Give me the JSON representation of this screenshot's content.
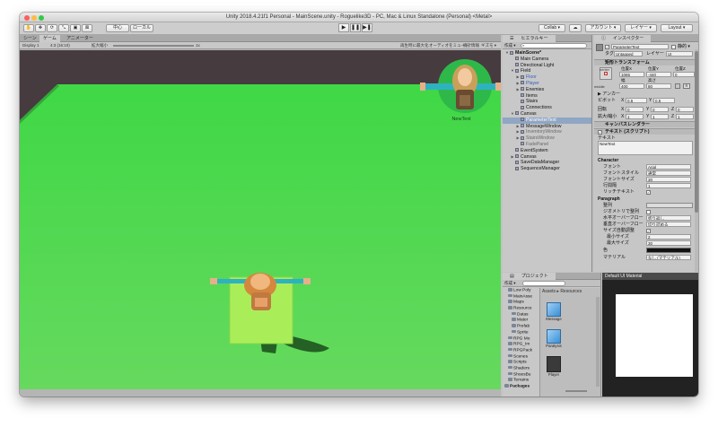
{
  "window": {
    "title": "Unity 2018.4.21f1 Personal - MainScene.unity - Roguelike3D - PC, Mac & Linux Standalone (Personal) <Metal>"
  },
  "toolbar": {
    "pivot_label": "中心",
    "space_label": "ローカル",
    "collab_label": "Collab ▾",
    "account_label": "アカウント ▾",
    "layers_label": "レイヤー ▾",
    "layout_label": "Layout ▾"
  },
  "scene": {
    "tabs": [
      "シーン",
      "ゲーム",
      "アニメーター"
    ],
    "display_label": "Display 1",
    "aspect_label": "4:3 (16:10)",
    "scale_label": "拡大縮小",
    "scale_value": "1x",
    "maximize_label": "再生時に最大化",
    "mute_label": "オーディオをミュート",
    "stats_label": "統計情報",
    "gizmos_label": "ギズモ ▾",
    "enemy_label": "NewText"
  },
  "hierarchy": {
    "tab_label": "ヒエラルキー",
    "create_label": "作成 ▾",
    "items": [
      {
        "label": "MainScene*",
        "indent": 0,
        "arrow": "▼",
        "style": "bold"
      },
      {
        "label": "Main Camera",
        "indent": 1,
        "arrow": "",
        "style": ""
      },
      {
        "label": "Directional Light",
        "indent": 1,
        "arrow": "",
        "style": ""
      },
      {
        "label": "Field",
        "indent": 1,
        "arrow": "▼",
        "style": ""
      },
      {
        "label": "Floor",
        "indent": 2,
        "arrow": "▶",
        "style": "blue"
      },
      {
        "label": "Player",
        "indent": 2,
        "arrow": "▶",
        "style": "blue"
      },
      {
        "label": "Enemies",
        "indent": 2,
        "arrow": "▶",
        "style": ""
      },
      {
        "label": "Items",
        "indent": 2,
        "arrow": "",
        "style": ""
      },
      {
        "label": "Stairs",
        "indent": 2,
        "arrow": "",
        "style": ""
      },
      {
        "label": "Connections",
        "indent": 2,
        "arrow": "",
        "style": ""
      },
      {
        "label": "Canvas",
        "indent": 1,
        "arrow": "▼",
        "style": ""
      },
      {
        "label": "ParameterText",
        "indent": 2,
        "arrow": "",
        "style": "sel"
      },
      {
        "label": "MessageWindow",
        "indent": 2,
        "arrow": "▶",
        "style": ""
      },
      {
        "label": "InventoryWindow",
        "indent": 2,
        "arrow": "▶",
        "style": "dim"
      },
      {
        "label": "StairsWindow",
        "indent": 2,
        "arrow": "▶",
        "style": "dim"
      },
      {
        "label": "FadePanel",
        "indent": 2,
        "arrow": "",
        "style": "dim"
      },
      {
        "label": "EventSystem",
        "indent": 1,
        "arrow": "",
        "style": ""
      },
      {
        "label": "Canvas",
        "indent": 1,
        "arrow": "▶",
        "style": ""
      },
      {
        "label": "SaveDataManager",
        "indent": 1,
        "arrow": "",
        "style": ""
      },
      {
        "label": "SequenceManager",
        "indent": 1,
        "arrow": "",
        "style": ""
      }
    ]
  },
  "inspector": {
    "tab_label": "インスペクター",
    "object_name": "ParameterText",
    "static_label": "静的 ▾",
    "tag_label": "タグ",
    "tag_value": "Untagged",
    "layer_label": "レイヤー",
    "layer_value": "UI",
    "rect_header": "矩形トランスフォーム",
    "center_label": "center",
    "middle_label": "middle",
    "posx_label": "位置X",
    "posy_label": "位置Y",
    "posz_label": "位置Z",
    "posx": "1065",
    "posy": "-440",
    "posz": "0",
    "width_label": "幅",
    "height_label": "高さ",
    "width": "400",
    "height": "80",
    "anchor_label": "▶ アンカー",
    "pivot_label": "ピボット",
    "pivot_x": "0.5",
    "pivot_y": "0.5",
    "rotation_label": "回転",
    "rot_x": "0",
    "rot_y": "0",
    "rot_z": "0",
    "scale_label": "拡大/縮小",
    "scale_x": "1",
    "scale_y": "1",
    "scale_z": "1",
    "canvas_renderer": "キャンバスレンダラー",
    "text_script": "テキスト (スクリプト)",
    "text_label": "テキスト",
    "text_value": "NewText",
    "character_header": "Character",
    "font_label": "フォント",
    "font_value": "Arial",
    "font_style_label": "フォントスタイル",
    "font_style_value": "通常",
    "font_size_label": "フォントサイズ",
    "font_size_value": "30",
    "line_spacing_label": "行間隔",
    "line_spacing_value": "1",
    "rich_text_label": "リッチテキスト",
    "paragraph_header": "Paragraph",
    "alignment_label": "整列",
    "geometry_label": "ジオメトリで整列",
    "h_overflow_label": "水平オーバーフロー",
    "h_overflow_value": "折り返し",
    "v_overflow_label": "垂直オーバーフロー",
    "v_overflow_value": "切り詰める",
    "best_fit_label": "サイズ自動調整",
    "min_size_label": "最小サイズ",
    "min_size_value": "2",
    "max_size_label": "最大サイズ",
    "max_size_value": "30",
    "color_label": "色",
    "material_label": "マテリアル",
    "material_value": "なし (マテリアル)"
  },
  "project": {
    "tab_label": "プロジェクト",
    "create_label": "作成 ▾",
    "tree": [
      {
        "label": "Low Poly",
        "indent": 1
      },
      {
        "label": "MainAsse",
        "indent": 1
      },
      {
        "label": "Maps",
        "indent": 1
      },
      {
        "label": "Resource",
        "indent": 1
      },
      {
        "label": "Datas",
        "indent": 2
      },
      {
        "label": "Mater",
        "indent": 2
      },
      {
        "label": "Prefab",
        "indent": 2
      },
      {
        "label": "Sprite",
        "indent": 2
      },
      {
        "label": "RPG Mo",
        "indent": 1
      },
      {
        "label": "RPG_Im",
        "indent": 1
      },
      {
        "label": "RPGPack",
        "indent": 1
      },
      {
        "label": "Scenes",
        "indent": 1
      },
      {
        "label": "Scripts",
        "indent": 1
      },
      {
        "label": "Shaders",
        "indent": 1
      },
      {
        "label": "ShoesBu",
        "indent": 1
      },
      {
        "label": "Terrains",
        "indent": 1
      },
      {
        "label": "Packages",
        "indent": 0
      }
    ],
    "breadcrumb_assets": "Assets",
    "breadcrumb_resources": "Resources",
    "assets": [
      "Message",
      "Paralysis",
      "Player"
    ]
  },
  "preview": {
    "title": "Default UI Material"
  },
  "colors": {
    "floor_green": "#56d654",
    "ground_green": "#43c24a",
    "tile_lime": "#a9ee59",
    "selection_blue": "#8fa6c4"
  }
}
